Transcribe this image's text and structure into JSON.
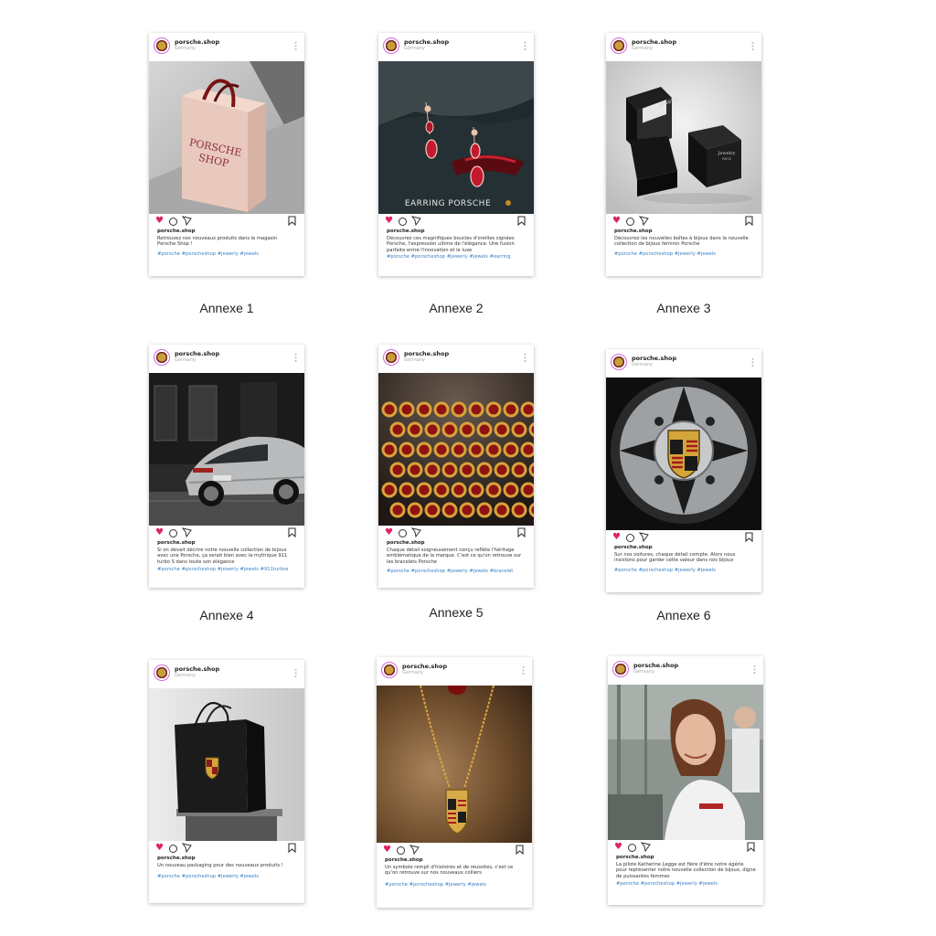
{
  "account": "porsche.shop",
  "location": "Germany",
  "colors": {
    "like": "#e0245e",
    "hashtag": "#3b82c4",
    "avatar_ring": "#d36ad6"
  },
  "icons": {
    "like": "heart-icon",
    "comment": "comment-icon",
    "share": "send-icon",
    "save": "bookmark-icon",
    "more": "more-vertical-icon"
  },
  "posts": [
    {
      "annex": "Annexe 1",
      "image_text_1": "PORSCHE",
      "image_text_2": "SHOP",
      "username": "porsche.shop",
      "caption": "Retrouvez nos nouveaux produits dans le magasin Porsche Shop !",
      "hashtags": "#porsche #porscheshop #jewerly #jewels"
    },
    {
      "annex": "Annexe 2",
      "image_text": "EARRING PORSCHE",
      "username": "porsche.shop",
      "caption": "Découvrez ces magnifiques boucles d'oreilles signées Porsche, l'expression ultime de l'élégance. Une fusion parfaite entre l'innovation et le luxe",
      "hashtags": "#porsche #porscheshop #jewerly #jewels #earring"
    },
    {
      "annex": "Annexe 3",
      "image_text_1": "Jewelry",
      "image_text_2": "PARIS",
      "username": "porsche.shop",
      "caption": "Découvrez les nouvelles boîtes à bijoux dans la nouvelle collection de bijoux féminin Porsche",
      "hashtags": "#porsche #porscheshop #jewerly #jewels"
    },
    {
      "annex": "Annexe 4",
      "username": "porsche.shop",
      "caption": "Si on devait décrire notre nouvelle collection de bijoux avec une Porsche, ça serait bien avec la mythique 911 turbo S dans toute son élégance",
      "hashtags": "#porsche #porscheshop #jewerly #jewels #911turbos"
    },
    {
      "annex": "Annexe 5",
      "username": "porsche.shop",
      "caption": "Chaque détail soigneusement conçu reflète l'héritage emblématique de la marque. C'est ce qu'on retrouve sur les bracelets Porsche",
      "hashtags": "#porsche #porscheshop #jewerly #jewels #bracelet"
    },
    {
      "annex": "Annexe 6",
      "username": "porsche.shop",
      "caption": "Sur nos voitures, chaque détail compte. Alors nous insistons pour garder cette valeur dans nos bijoux",
      "hashtags": "#porsche #porscheshop #jewerly #jewels"
    },
    {
      "username": "porsche.shop",
      "caption": "Un nouveau packaging pour des nouveaux produits !",
      "hashtags": "#porsche #porscheshop #jewerly #jewels"
    },
    {
      "username": "porsche.shop",
      "caption": "Un symbole rempli d'histoires et de réussites, c'est ce qu'on retrouve sur nos nouveaux colliers",
      "hashtags": "#porsche #porscheshop #jewerly #jewels"
    },
    {
      "username": "porsche.shop",
      "caption": "La pilote Katherine Legge est fière d'être notre égérie pour représenter notre nouvelle collection de bijoux, digne de puissantes femmes",
      "hashtags": "#porsche #porscheshop #jewerly #jewels"
    }
  ]
}
